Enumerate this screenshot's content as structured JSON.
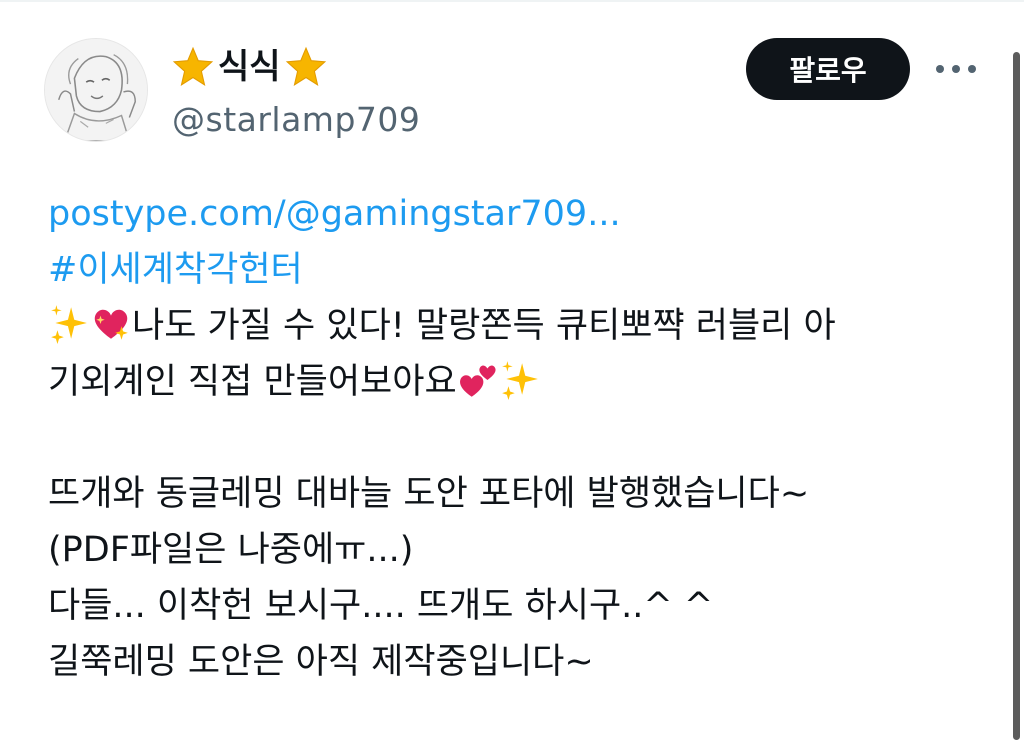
{
  "header": {
    "display_name": "식식",
    "handle": "@starlamp709",
    "follow_label": "팔로우",
    "icons": {
      "star_left": "star-emoji-icon",
      "star_right": "star-emoji-icon",
      "more": "more-horizontal-icon"
    }
  },
  "post": {
    "link": "postype.com/@gamingstar709...",
    "hashtag": "#이세계착각헌터",
    "line1": "나도 가질 수 있다! 말랑쫀득 큐티뽀쨕 러블리 아",
    "line2": "기외계인 직접 만들어보아요",
    "line3": "뜨개와 동글레밍 대바늘 도안 포타에 발행했습니다~",
    "line4": "(PDF파일은 나중에ㅠ...)",
    "line5": "다들... 이착헌 보시구.... 뜨개도 하시구..^ ^",
    "line6": "길쭉레밍 도안은 아직 제작중입니다~",
    "emoji": [
      "sparkles-icon",
      "heart-with-sparkles-icon",
      "two-hearts-icon",
      "sparkles-icon"
    ]
  },
  "colors": {
    "link": "#1d9bf0",
    "text": "#0f1419",
    "muted": "#536471",
    "button_bg": "#0f1419",
    "button_fg": "#ffffff",
    "star": "#f7b500",
    "heart": "#e0245e",
    "sparkle": "#ffc107"
  }
}
